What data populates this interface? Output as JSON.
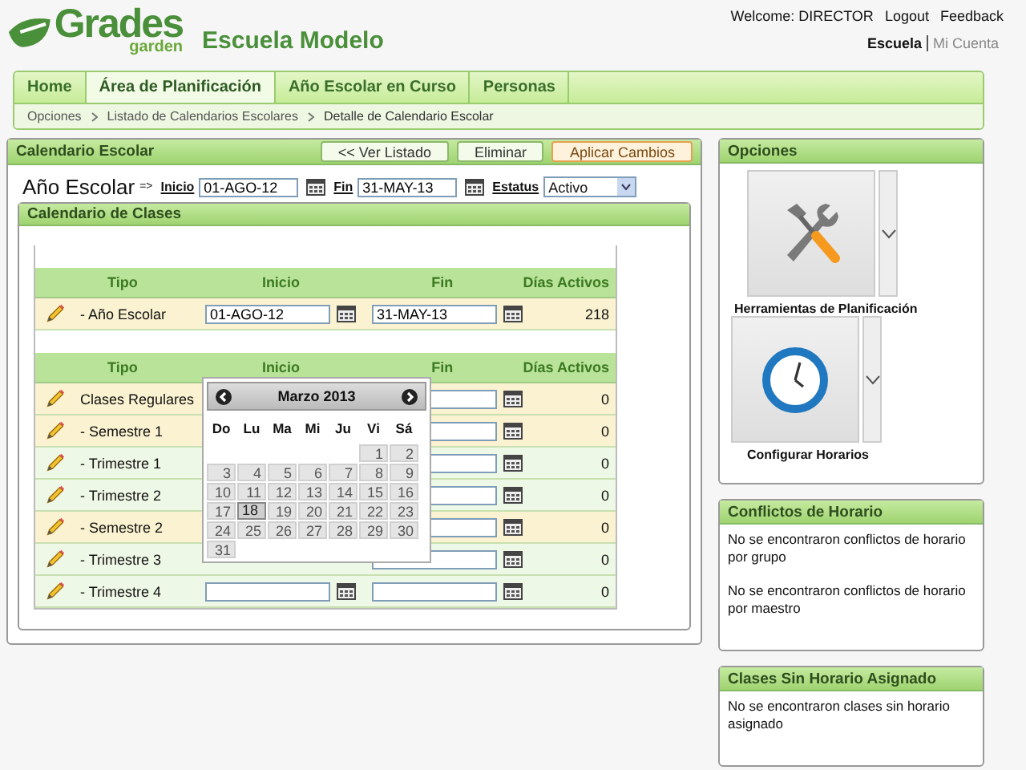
{
  "logo": {
    "word": "Grades",
    "sub": "garden"
  },
  "school": "Escuela Modelo",
  "user": {
    "welcome": "Welcome: DIRECTOR",
    "links": [
      "Logout",
      "Feedback"
    ]
  },
  "context_links": [
    {
      "label": "Escuela",
      "selected": true
    },
    {
      "label": "Mi Cuenta",
      "selected": false
    }
  ],
  "tabs": [
    {
      "label": "Home",
      "selected": false
    },
    {
      "label": "Área de Planificación",
      "selected": true
    },
    {
      "label": "Año Escolar en Curso",
      "selected": false
    },
    {
      "label": "Personas",
      "selected": false
    }
  ],
  "breadcrumb": [
    "Opciones",
    "Listado de Calendarios Escolares",
    "Detalle de Calendario Escolar"
  ],
  "main": {
    "title": "Calendario Escolar",
    "buttons": [
      {
        "label": "<< Ver Listado",
        "kind": "normal"
      },
      {
        "label": "Eliminar",
        "kind": "normal"
      },
      {
        "label": "Aplicar Cambios",
        "kind": "primary"
      }
    ],
    "year_label": "Año Escolar",
    "arrow": "=>",
    "inicio_label": "Inicio",
    "inicio": "01-AGO-12",
    "fin_label": "Fin",
    "fin": "31-MAY-13",
    "estatus_label": "Estatus",
    "estatus": "Activo"
  },
  "classes": {
    "title": "Calendario de Clases",
    "columns": [
      "Tipo",
      "Inicio",
      "Fin",
      "Días Activos"
    ],
    "year_rows": [
      {
        "tipo": "- Año Escolar",
        "inicio": "01-AGO-12",
        "fin": "31-MAY-13",
        "dias": "218",
        "kind": "main"
      }
    ],
    "columns_2": [
      "Tipo",
      "Inicio",
      "Fin",
      "Días Activos"
    ],
    "rows": [
      {
        "tipo": "Clases Regulares",
        "dias": "0",
        "kind": "main"
      },
      {
        "tipo": "- Semestre 1",
        "dias": "0",
        "kind": "main"
      },
      {
        "tipo": "- Trimestre 1",
        "dias": "0",
        "kind": "sub"
      },
      {
        "tipo": "- Trimestre 2",
        "dias": "0",
        "kind": "sub"
      },
      {
        "tipo": "- Semestre 2",
        "dias": "0",
        "kind": "main"
      },
      {
        "tipo": "- Trimestre 3",
        "dias": "0",
        "kind": "sub"
      },
      {
        "tipo": "- Trimestre 4",
        "dias": "0",
        "kind": "sub"
      }
    ]
  },
  "datepicker": {
    "month": "Marzo 2013",
    "weekdays": [
      "Do",
      "Lu",
      "Ma",
      "Mi",
      "Ju",
      "Vi",
      "Sá"
    ],
    "weeks": [
      [
        {
          "kind": "empty"
        },
        {
          "kind": "empty"
        },
        {
          "kind": "empty"
        },
        {
          "kind": "empty"
        },
        {
          "kind": "empty"
        },
        {
          "d": "1",
          "selected": false
        },
        {
          "d": "2",
          "selected": false
        }
      ],
      [
        {
          "d": "3",
          "selected": false
        },
        {
          "d": "4",
          "selected": false
        },
        {
          "d": "5",
          "selected": false
        },
        {
          "d": "6",
          "selected": false
        },
        {
          "d": "7",
          "selected": false
        },
        {
          "d": "8",
          "selected": false
        },
        {
          "d": "9",
          "selected": false
        }
      ],
      [
        {
          "d": "10",
          "selected": false
        },
        {
          "d": "11",
          "selected": false
        },
        {
          "d": "12",
          "selected": false
        },
        {
          "d": "13",
          "selected": false
        },
        {
          "d": "14",
          "selected": false
        },
        {
          "d": "15",
          "selected": false
        },
        {
          "d": "16",
          "selected": false
        }
      ],
      [
        {
          "d": "17",
          "selected": false
        },
        {
          "d": "18",
          "selected": true
        },
        {
          "d": "19",
          "selected": false
        },
        {
          "d": "20",
          "selected": false
        },
        {
          "d": "21",
          "selected": false
        },
        {
          "d": "22",
          "selected": false
        },
        {
          "d": "23",
          "selected": false
        }
      ],
      [
        {
          "d": "24",
          "selected": false
        },
        {
          "d": "25",
          "selected": false
        },
        {
          "d": "26",
          "selected": false
        },
        {
          "d": "27",
          "selected": false
        },
        {
          "d": "28",
          "selected": false
        },
        {
          "d": "29",
          "selected": false
        },
        {
          "d": "30",
          "selected": false
        }
      ],
      [
        {
          "d": "31",
          "selected": false
        }
      ]
    ]
  },
  "options": {
    "title": "Opciones",
    "items": [
      {
        "label": "Herramientas de Planificación",
        "kind": "tools"
      },
      {
        "label": "Configurar Horarios",
        "kind": "clock"
      }
    ]
  },
  "conflicts": {
    "title": "Conflictos de Horario",
    "messages": [
      "No se encontraron conflictos de horario por grupo",
      "No se encontraron conflictos de horario por maestro"
    ]
  },
  "unassigned": {
    "title": "Clases Sin Horario Asignado",
    "messages": [
      "No se encontraron clases sin horario asignado"
    ]
  }
}
